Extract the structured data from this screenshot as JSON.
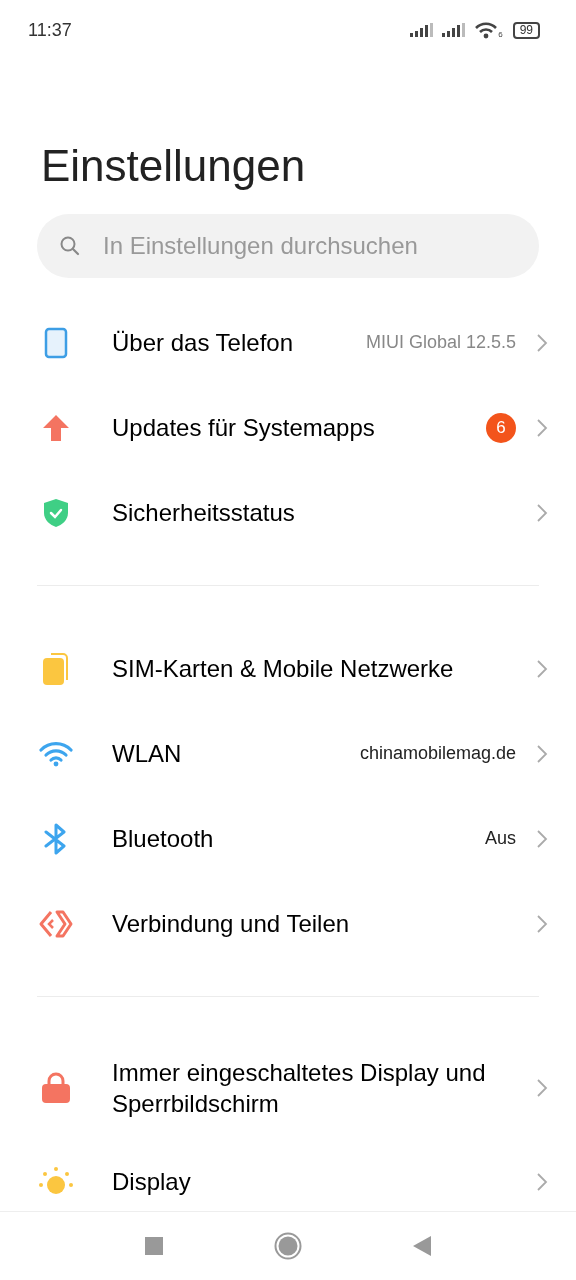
{
  "status_bar": {
    "time": "11:37",
    "wifi_label": "6",
    "battery": "99"
  },
  "title": "Einstellungen",
  "search": {
    "placeholder": "In Einstellungen durchsuchen"
  },
  "sections": [
    {
      "items": [
        {
          "label": "Über das Telefon",
          "value": "MIUI Global 12.5.5"
        },
        {
          "label": "Updates für Systemapps",
          "badge": "6"
        },
        {
          "label": "Sicherheitsstatus"
        }
      ]
    },
    {
      "items": [
        {
          "label": "SIM-Karten & Mobile Netzwerke"
        },
        {
          "label": "WLAN",
          "value": "chinamobilemag.de"
        },
        {
          "label": "Bluetooth",
          "value": "Aus"
        },
        {
          "label": "Verbindung und Teilen"
        }
      ]
    },
    {
      "items": [
        {
          "label": "Immer eingeschaltetes Display und Sperrbildschirm"
        },
        {
          "label": "Display"
        }
      ]
    }
  ]
}
